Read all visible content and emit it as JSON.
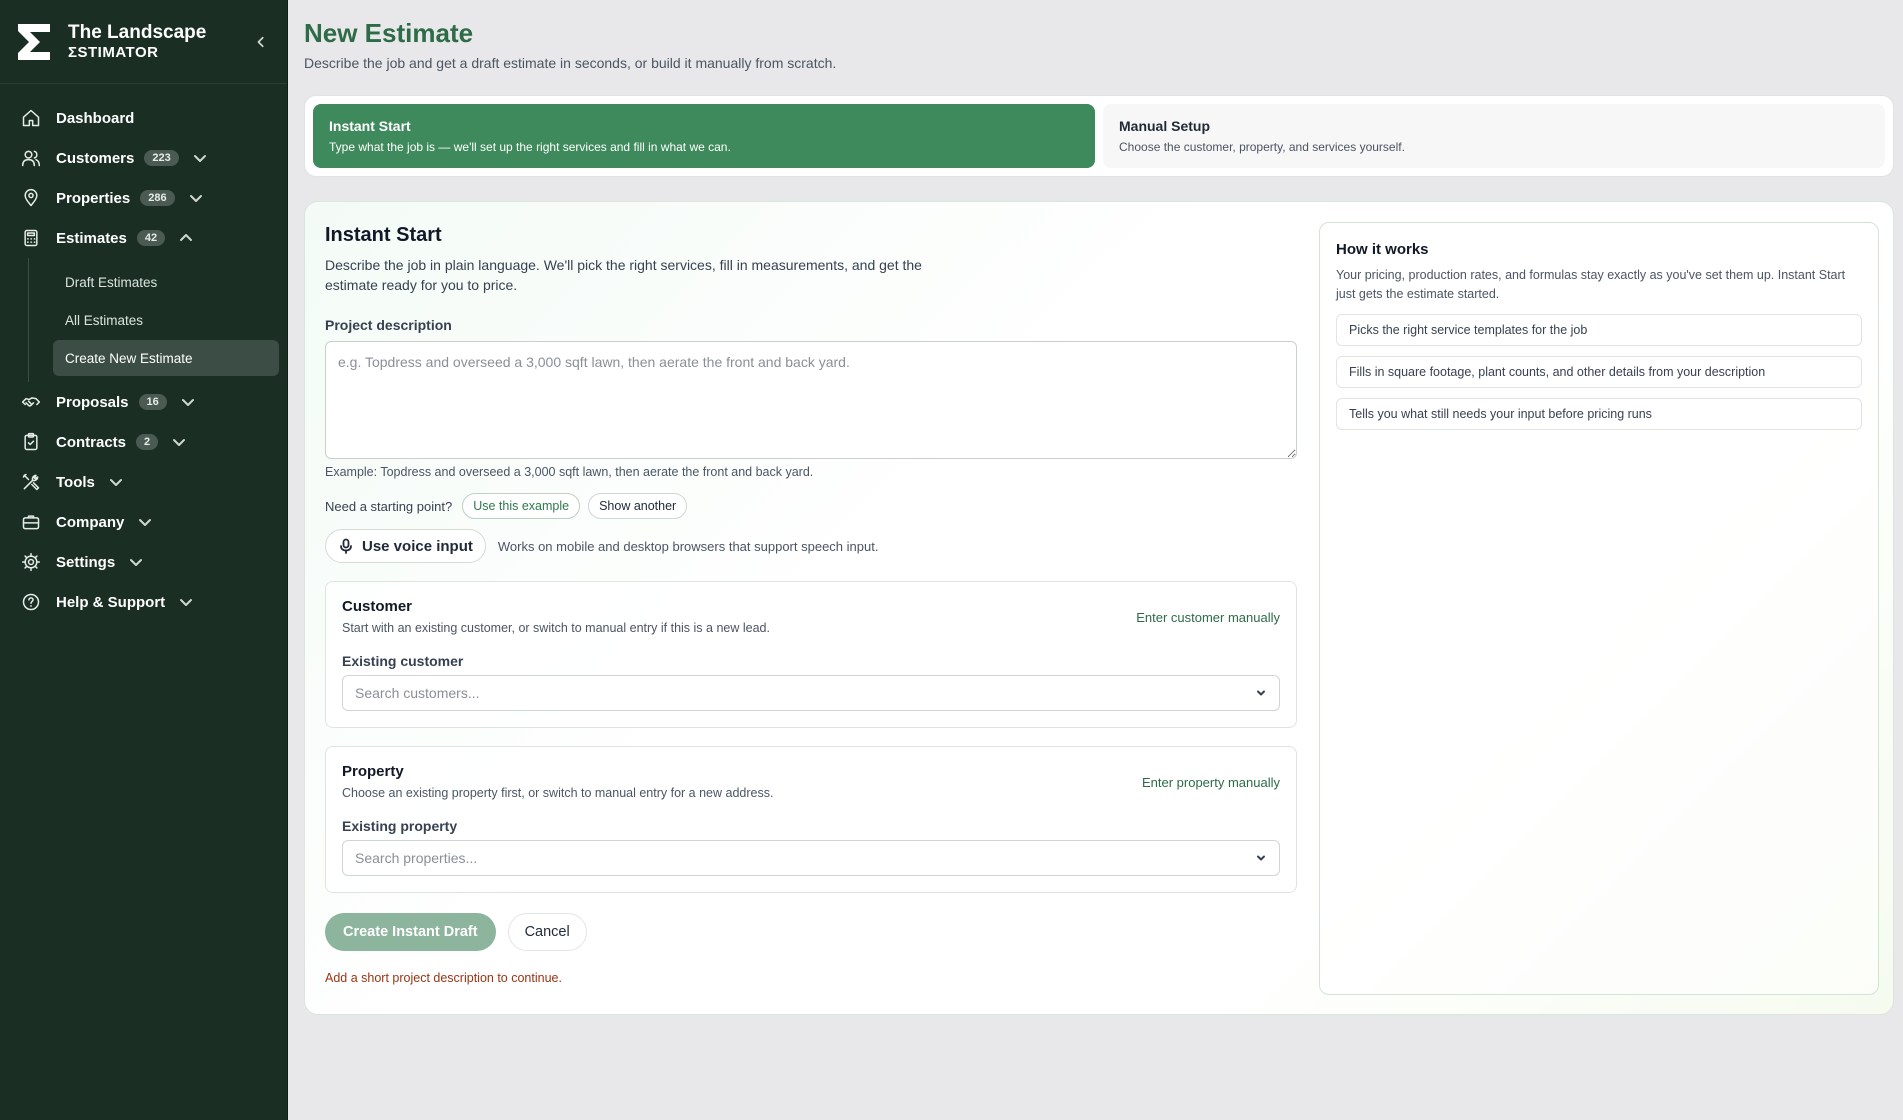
{
  "brand": {
    "line1": "The Landscape",
    "line2": "ΣSTIMATOR"
  },
  "sidebar": {
    "items": [
      {
        "label": "Dashboard"
      },
      {
        "label": "Customers",
        "badge": "223"
      },
      {
        "label": "Properties",
        "badge": "286"
      },
      {
        "label": "Estimates",
        "badge": "42"
      },
      {
        "label": "Proposals",
        "badge": "16"
      },
      {
        "label": "Contracts",
        "badge": "2"
      },
      {
        "label": "Tools"
      },
      {
        "label": "Company"
      },
      {
        "label": "Settings"
      },
      {
        "label": "Help & Support"
      }
    ],
    "estimates_sub": [
      {
        "label": "Draft Estimates"
      },
      {
        "label": "All Estimates"
      },
      {
        "label": "Create New Estimate"
      }
    ]
  },
  "page": {
    "title": "New Estimate",
    "subtitle": "Describe the job and get a draft estimate in seconds, or build it manually from scratch."
  },
  "modes": {
    "instant": {
      "title": "Instant Start",
      "desc": "Type what the job is — we'll set up the right services and fill in what we can."
    },
    "manual": {
      "title": "Manual Setup",
      "desc": "Choose the customer, property, and services yourself."
    }
  },
  "instant": {
    "title": "Instant Start",
    "desc": "Describe the job in plain language. We'll pick the right services, fill in measurements, and get the estimate ready for you to price.",
    "description_label": "Project description",
    "description_placeholder": "e.g. Topdress and overseed a 3,000 sqft lawn, then aerate the front and back yard.",
    "description_value": "",
    "example": "Example: Topdress and overseed a 3,000 sqft lawn, then aerate the front and back yard.",
    "starter_label": "Need a starting point?",
    "use_example": "Use this example",
    "show_another": "Show another",
    "voice_label": "Use voice input",
    "voice_note": "Works on mobile and desktop browsers that support speech input."
  },
  "customer": {
    "title": "Customer",
    "desc": "Start with an existing customer, or switch to manual entry if this is a new lead.",
    "manual_link": "Enter customer manually",
    "label": "Existing customer",
    "placeholder": "Search customers..."
  },
  "property": {
    "title": "Property",
    "desc": "Choose an existing property first, or switch to manual entry for a new address.",
    "manual_link": "Enter property manually",
    "label": "Existing property",
    "placeholder": "Search properties..."
  },
  "actions": {
    "create": "Create Instant Draft",
    "cancel": "Cancel",
    "warning": "Add a short project description to continue."
  },
  "how": {
    "title": "How it works",
    "desc": "Your pricing, production rates, and formulas stay exactly as you've set them up. Instant Start just gets the estimate started.",
    "items": [
      "Picks the right service templates for the job",
      "Fills in square footage, plant counts, and other details from your description",
      "Tells you what still needs your input before pricing runs"
    ]
  },
  "colors": {
    "sidebar_bg": "#1a2e24",
    "accent": "#3f8a5c",
    "title_green": "#2e6b47",
    "warning": "#9a3412"
  }
}
